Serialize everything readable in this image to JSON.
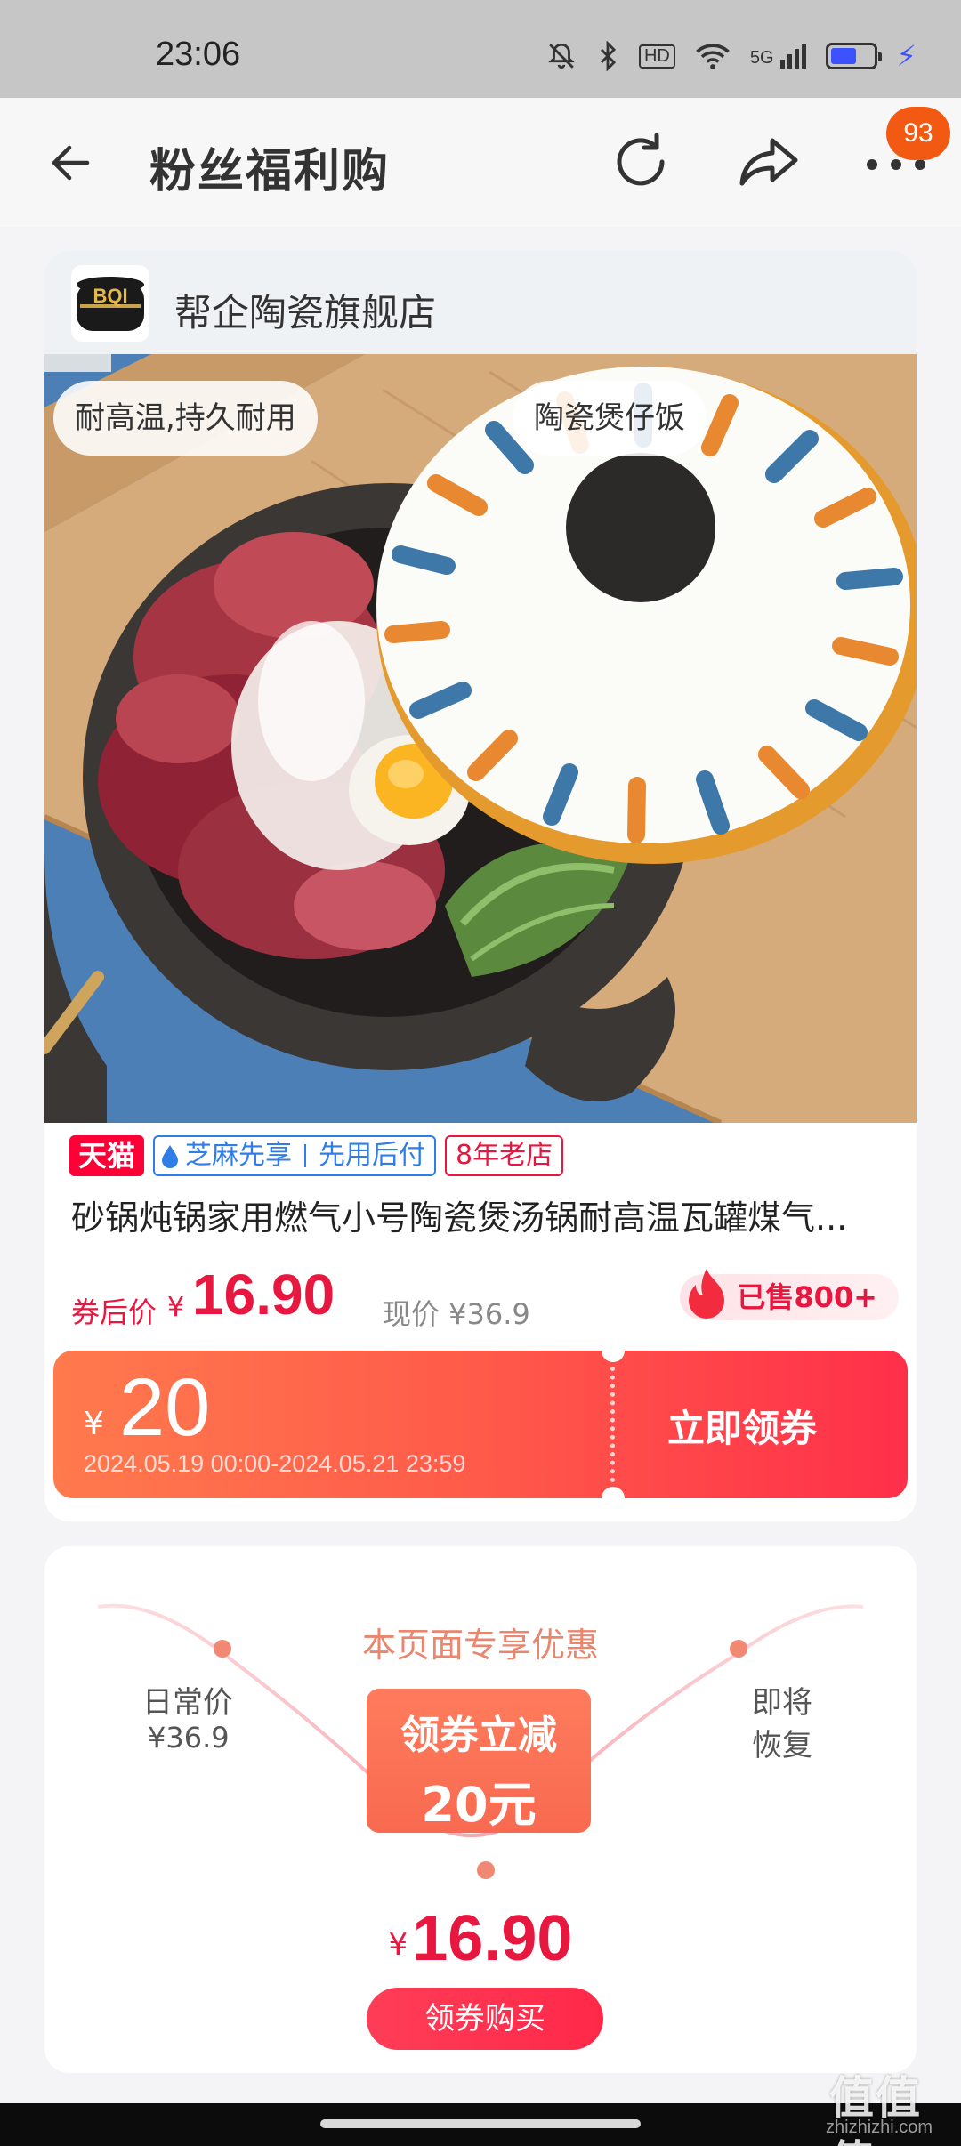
{
  "status_bar": {
    "time": "23:06",
    "hd": "HD",
    "signal": "5G"
  },
  "header": {
    "title": "粉丝福利购",
    "message_count": "93"
  },
  "store": {
    "name": "帮企陶瓷旗舰店",
    "logo_text": "BQI"
  },
  "product": {
    "image_tags": [
      "耐高温,持久耐用",
      "陶瓷煲仔饭"
    ],
    "badges": {
      "tmall": "天猫",
      "zhima_a": "芝麻先享",
      "zhima_b": "先用后付",
      "old_store": "8年老店"
    },
    "title": "砂锅炖锅家用燃气小号陶瓷煲汤锅耐高温瓦罐煤气...",
    "price_label": "券后价",
    "price_currency": "¥",
    "price_value": "16.90",
    "current_price": "现价 ¥36.9",
    "sold": "已售800+"
  },
  "coupon": {
    "currency": "¥",
    "amount": "20",
    "validity": "2024.05.19 00:00-2024.05.21 23:59",
    "button": "立即领券"
  },
  "exclusive": {
    "title": "本页面专享优惠",
    "daily_label": "日常价",
    "daily_price": "¥36.9",
    "restore_line1": "即将",
    "restore_line2": "恢复",
    "cut_line1": "领券立减",
    "cut_line2": "20元",
    "final_currency": "¥",
    "final_price": "16.90",
    "buy_button": "领券购买"
  },
  "watermark": {
    "main": "值值值",
    "sub": "zhizhizhi.com"
  },
  "colors": {
    "accent_red": "#e8173f",
    "coupon_orange": "#ff7a4d",
    "badge_orange": "#f25a14"
  }
}
